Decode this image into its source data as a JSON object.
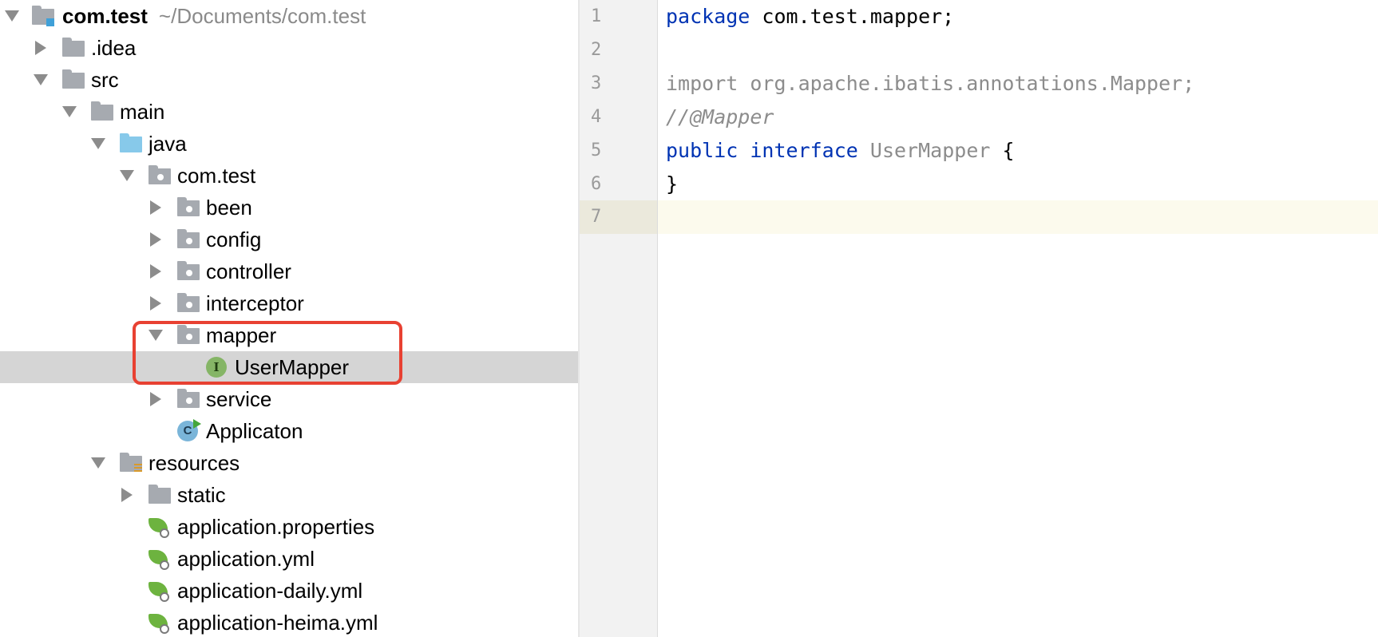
{
  "project": {
    "name": "com.test",
    "path": "~/Documents/com.test"
  },
  "tree": {
    "idea": ".idea",
    "src": "src",
    "main": "main",
    "java": "java",
    "package": "com.test",
    "been": "been",
    "config": "config",
    "controller": "controller",
    "interceptor": "interceptor",
    "mapper": "mapper",
    "usermapper": "UserMapper",
    "usermapper_badge": "I",
    "service": "service",
    "applicaton": "Applicaton",
    "applicaton_badge": "C",
    "resources": "resources",
    "static": "static",
    "files": [
      "application.properties",
      "application.yml",
      "application-daily.yml",
      "application-heima.yml"
    ],
    "selected": "UserMapper"
  },
  "editor": {
    "line_numbers": [
      "1",
      "2",
      "3",
      "4",
      "5",
      "6",
      "7"
    ],
    "current_line": 7,
    "lines": {
      "l1_kw": "package",
      "l1_rest": " com.test.mapper;",
      "l3": "import org.apache.ibatis.annotations.Mapper;",
      "l4": "//@Mapper",
      "l5_kw1": "public",
      "l5_kw2": "interface",
      "l5_name": "UserMapper",
      "l5_brace": " {",
      "l6": "}"
    }
  },
  "colors": {
    "highlight_box": "#e84132",
    "selection": "#d5d5d5",
    "keyword": "#0033b3",
    "current_line": "#fcfaed"
  }
}
